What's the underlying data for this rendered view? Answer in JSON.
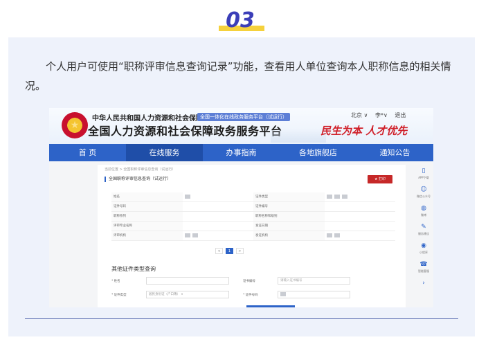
{
  "section": {
    "number": "03"
  },
  "article": {
    "paragraph": "个人用户可使用“职称评审信息查询记录”功能，查看用人单位查询本人职称信息的相关情况。"
  },
  "screenshot": {
    "department": "中华人民共和国人力资源和社会保障部",
    "tagline": "全国一体化在线政务服务平台（试运行）",
    "platform_name": "全国人力资源和社会保障政务服务平台",
    "slogan": "民生为本 人才优先",
    "top_links": {
      "location": "北京 ∨",
      "user": "李*∨",
      "logout": "退出"
    },
    "nav": [
      {
        "label": "首 页",
        "active": false
      },
      {
        "label": "在线服务",
        "active": true
      },
      {
        "label": "办事指南",
        "active": false
      },
      {
        "label": "各地旗舰店",
        "active": false
      },
      {
        "label": "通知公告",
        "active": false
      }
    ],
    "breadcrumb": "当前位置 > 全国职称评审信息查询（试运行）",
    "panel_title": "全国职称评审信息查询（试运行）",
    "print_label": "打印",
    "info_rows": [
      [
        "姓名",
        "",
        "证件类型",
        ""
      ],
      [
        "证件号码",
        "",
        "证件编号",
        ""
      ],
      [
        "职称系列",
        "",
        "职称名称和级别",
        ""
      ],
      [
        "评审专业名称",
        "",
        "发证日期",
        ""
      ],
      [
        "评审机构",
        "",
        "发证机构",
        ""
      ]
    ],
    "pager": [
      "<",
      "1",
      ">"
    ],
    "other_query_title": "其他证件类型查询",
    "form": {
      "name_label": "* 姓名",
      "cert_no_label": "证书编号",
      "cert_no_placeholder": "请输入证书编号",
      "id_type_label": "* 证件类型",
      "id_type_value": "居民身份证（户口簿）",
      "id_no_label": "* 证件号码"
    },
    "side_tools": [
      {
        "icon": "phone-icon",
        "glyph": "▯",
        "label": "APP下载"
      },
      {
        "icon": "wechat-icon",
        "glyph": "☺",
        "label": "微信公众号"
      },
      {
        "icon": "weibo-icon",
        "glyph": "◍",
        "label": "微博"
      },
      {
        "icon": "feedback-icon",
        "glyph": "✎",
        "label": "服务建议"
      },
      {
        "icon": "assistant-icon",
        "glyph": "◉",
        "label": "小程序"
      },
      {
        "icon": "support-icon",
        "glyph": "☎",
        "label": "智能客服"
      },
      {
        "icon": "chevron-right-icon",
        "glyph": "›",
        "label": ""
      }
    ]
  }
}
